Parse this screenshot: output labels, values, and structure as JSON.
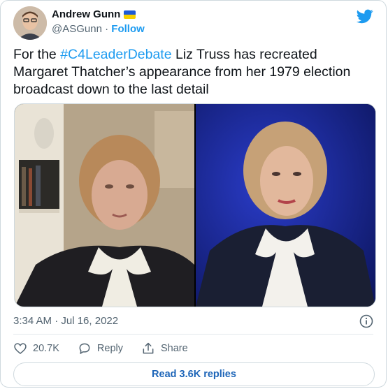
{
  "author": {
    "display_name": "Andrew Gunn",
    "handle": "@ASGunn",
    "separator": " · ",
    "follow_label": "Follow",
    "flag": "ukraine-flag"
  },
  "tweet": {
    "text_before": "For the ",
    "hashtag": "#C4LeaderDebate",
    "text_after": " Liz Truss has recreated Margaret Thatcher’s appearance from her 1979 election broadcast down to the last detail",
    "timestamp": "3:34 AM · Jul 16, 2022"
  },
  "media": {
    "left_photo": "Margaret Thatcher 1979 broadcast",
    "right_photo": "Liz Truss debate"
  },
  "actions": {
    "likes_count": "20.7K",
    "reply_label": "Reply",
    "share_label": "Share"
  },
  "replies_button": "Read 3.6K replies",
  "colors": {
    "accent": "#1d9bf0",
    "muted": "#536471",
    "text": "#0f1419",
    "border": "#cfd9de"
  }
}
